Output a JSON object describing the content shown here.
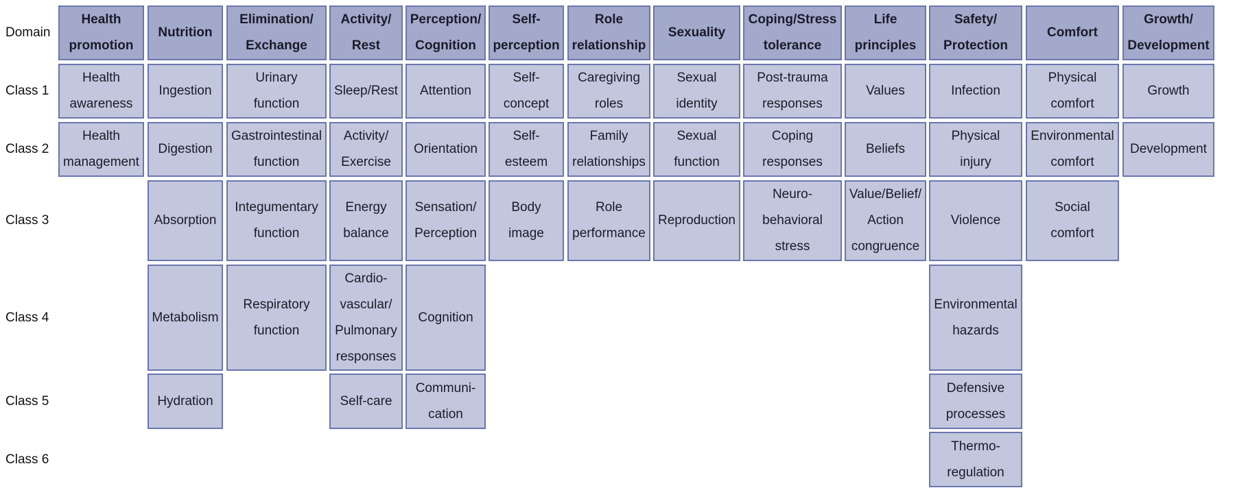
{
  "row_labels": [
    "Domain",
    "Class 1",
    "Class 2",
    "Class 3",
    "Class 4",
    "Class 5",
    "Class 6"
  ],
  "domains": [
    "Health\npromotion",
    "Nutrition",
    "Elimination/\nExchange",
    "Activity/\nRest",
    "Perception/\nCognition",
    "Self-\nperception",
    "Role\nrelationship",
    "Sexuality",
    "Coping/Stress\ntolerance",
    "Life\nprinciples",
    "Safety/\nProtection",
    "Comfort",
    "Growth/\nDevelopment"
  ],
  "classes": [
    [
      "Health\nawareness",
      "Ingestion",
      "Urinary\nfunction",
      "Sleep/Rest",
      "Attention",
      "Self-\nconcept",
      "Caregiving\nroles",
      "Sexual\nidentity",
      "Post-trauma\nresponses",
      "Values",
      "Infection",
      "Physical\ncomfort",
      "Growth"
    ],
    [
      "Health\nmanagement",
      "Digestion",
      "Gastrointestinal\nfunction",
      "Activity/\nExercise",
      "Orientation",
      "Self-\nesteem",
      "Family\nrelationships",
      "Sexual\nfunction",
      "Coping\nresponses",
      "Beliefs",
      "Physical\ninjury",
      "Environmental\ncomfort",
      "Development"
    ],
    [
      null,
      "Absorption",
      "Integumentary\nfunction",
      "Energy\nbalance",
      "Sensation/\nPerception",
      "Body\nimage",
      "Role\nperformance",
      "Reproduction",
      "Neuro-\nbehavioral\nstress",
      "Value/Belief/\nAction\ncongruence",
      "Violence",
      "Social\ncomfort",
      null
    ],
    [
      null,
      "Metabolism",
      "Respiratory\nfunction",
      "Cardio-\nvascular/\nPulmonary\nresponses",
      "Cognition",
      null,
      null,
      null,
      null,
      null,
      "Environmental\nhazards",
      null,
      null
    ],
    [
      null,
      "Hydration",
      null,
      "Self-care",
      "Communi-\ncation",
      null,
      null,
      null,
      null,
      null,
      "Defensive\nprocesses",
      null,
      null
    ],
    [
      null,
      null,
      null,
      null,
      null,
      null,
      null,
      null,
      null,
      null,
      "Thermo-\nregulation",
      null,
      null
    ]
  ]
}
